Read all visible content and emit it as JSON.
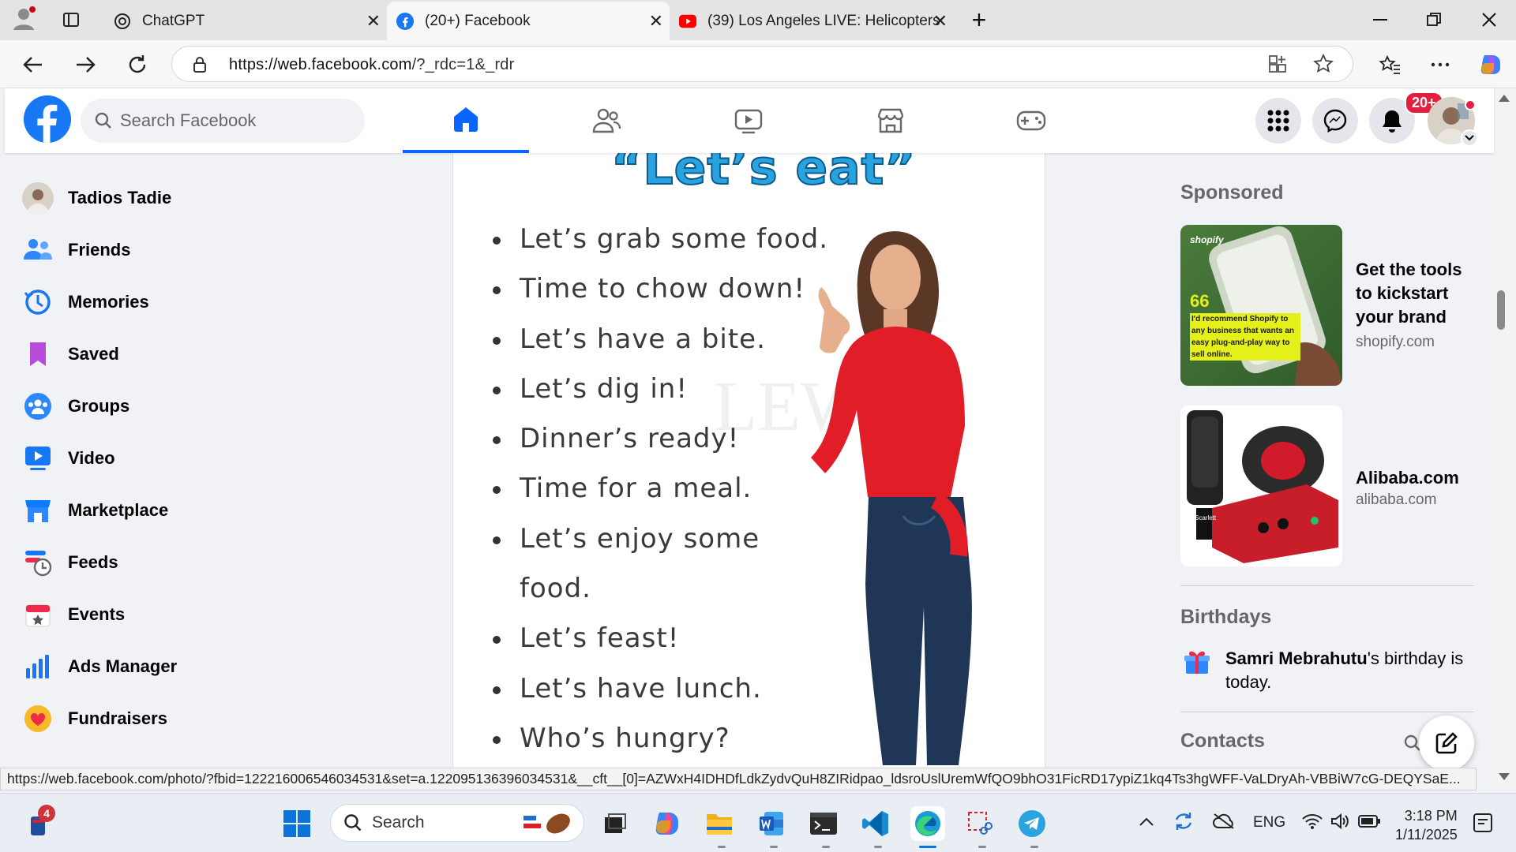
{
  "browser": {
    "tabs": [
      {
        "title": "ChatGPT",
        "close": "✕"
      },
      {
        "title": "(20+) Facebook",
        "close": "✕"
      },
      {
        "title": "(39) Los Angeles LIVE: Helicopters",
        "close": "✕"
      }
    ],
    "new_tab": "+",
    "url_host": "https://web.facebook.com",
    "url_path": "/?_rdc=1&_rdr"
  },
  "facebook": {
    "search_placeholder": "Search Facebook",
    "notifications_badge": "20+",
    "logo": "f"
  },
  "sidebar": {
    "items": [
      {
        "label": "Tadios Tadie",
        "icon": "avatar"
      },
      {
        "label": "Friends",
        "icon": "friends-icon"
      },
      {
        "label": "Memories",
        "icon": "memories-icon"
      },
      {
        "label": "Saved",
        "icon": "saved-icon"
      },
      {
        "label": "Groups",
        "icon": "groups-icon"
      },
      {
        "label": "Video",
        "icon": "video-icon"
      },
      {
        "label": "Marketplace",
        "icon": "marketplace-icon"
      },
      {
        "label": "Feeds",
        "icon": "feeds-icon"
      },
      {
        "label": "Events",
        "icon": "events-icon"
      },
      {
        "label": "Ads Manager",
        "icon": "ads-manager-icon"
      },
      {
        "label": "Fundraisers",
        "icon": "fundraisers-icon"
      }
    ]
  },
  "post": {
    "title": "“Let’s eat”",
    "phrases": [
      "Let’s grab some food.",
      "Time to chow down!",
      "Let’s have a bite.",
      "Let’s dig in!",
      "Dinner’s ready!",
      "Time for a meal.",
      "Let’s enjoy some",
      "food.",
      "Let’s feast!",
      "Let’s have lunch.",
      "Who’s hungry?"
    ],
    "watermark": "LEW"
  },
  "right": {
    "sponsored_heading": "Sponsored",
    "ads": [
      {
        "title": "Get the tools to kickstart your brand",
        "domain": "shopify.com",
        "brand": "shopify",
        "quote": "I'd recommend Shopify to any business that wants an easy plug-and-play way to sell online.",
        "quote_mark": "66"
      },
      {
        "title": "Alibaba.com",
        "domain": "alibaba.com",
        "product_label": "Scarlett"
      }
    ],
    "birthdays_heading": "Birthdays",
    "birthday_name": "Samri Mebrahutu",
    "birthday_text": "'s birthday is today.",
    "contacts_heading": "Contacts"
  },
  "status_url": "https://web.facebook.com/photo/?fbid=122216006546034531&set=a.122095136396034531&__cft__[0]=AZWxH4IDHDfLdkZydvQuH8ZIRidpao_ldsroUslUremWfQO9bhO31FicRD17ypiZ1kq4Ts3hgWFF-VaLDryAh-VBBiW7cG-DEQYSaE...",
  "taskbar": {
    "search": "Search",
    "lang": "ENG",
    "time": "3:18 PM",
    "date": "1/11/2025",
    "badge": "4"
  },
  "colors": {
    "fb_blue": "#1877f2",
    "nav_active": "#0866ff",
    "badge_red": "#e41e3f"
  }
}
